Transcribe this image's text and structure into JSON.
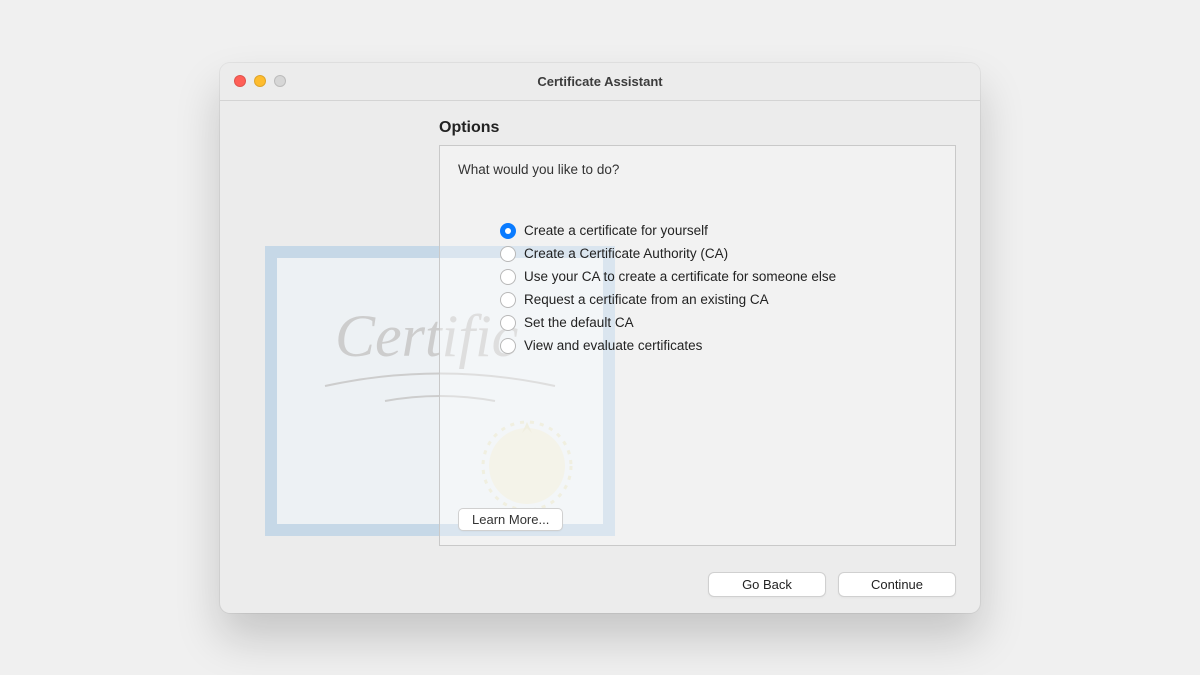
{
  "window": {
    "title": "Certificate Assistant"
  },
  "section": {
    "heading": "Options",
    "prompt": "What would you like to do?"
  },
  "options": [
    {
      "label": "Create a certificate for yourself",
      "selected": true,
      "name": "radio-create-self"
    },
    {
      "label": "Create a Certificate Authority (CA)",
      "selected": false,
      "name": "radio-create-ca"
    },
    {
      "label": "Use your CA to create a certificate for someone else",
      "selected": false,
      "name": "radio-use-ca"
    },
    {
      "label": "Request a certificate from an existing CA",
      "selected": false,
      "name": "radio-request-ca"
    },
    {
      "label": "Set the default CA",
      "selected": false,
      "name": "radio-default-ca"
    },
    {
      "label": "View and evaluate certificates",
      "selected": false,
      "name": "radio-view-cert"
    }
  ],
  "buttons": {
    "learn_more": "Learn More...",
    "go_back": "Go Back",
    "continue": "Continue"
  }
}
